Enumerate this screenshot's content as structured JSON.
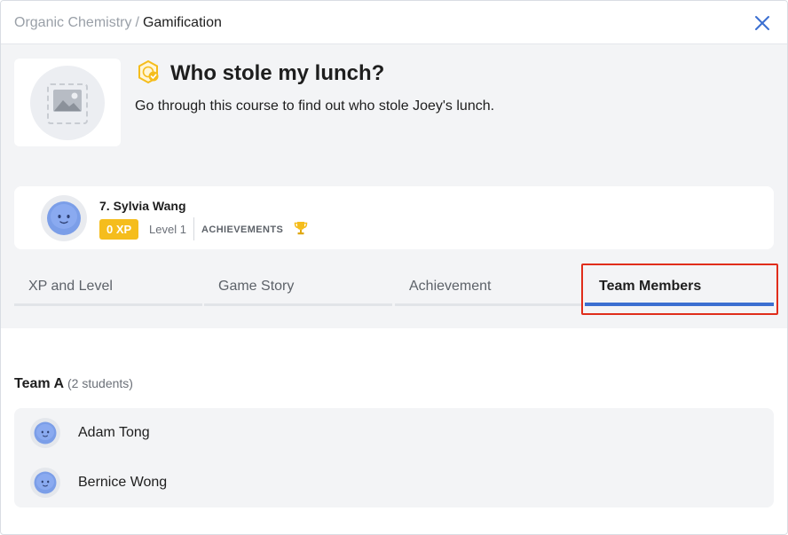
{
  "breadcrumb": {
    "parent": "Organic Chemistry",
    "separator": "/",
    "current": "Gamification"
  },
  "header": {
    "close_icon": "close-icon"
  },
  "course": {
    "icon": "badge-check-icon",
    "title": "Who stole my lunch?",
    "description": "Go through this course to find out who stole Joey's lunch."
  },
  "profile": {
    "name": "7. Sylvia Wang",
    "xp": "0 XP",
    "level": "Level 1",
    "achievements_label": "ACHIEVEMENTS",
    "achievement_icon": "trophy-icon"
  },
  "tabs": [
    {
      "label": "XP and Level",
      "active": false
    },
    {
      "label": "Game Story",
      "active": false
    },
    {
      "label": "Achievement",
      "active": false
    },
    {
      "label": "Team Members",
      "active": true
    }
  ],
  "team": {
    "name": "Team A",
    "count": "(2 students)",
    "members": [
      {
        "name": "Adam Tong"
      },
      {
        "name": "Bernice Wong"
      }
    ]
  },
  "colors": {
    "accent": "#3b6fd1",
    "xp_badge": "#f5bd1c",
    "highlight": "#e02d1b"
  }
}
